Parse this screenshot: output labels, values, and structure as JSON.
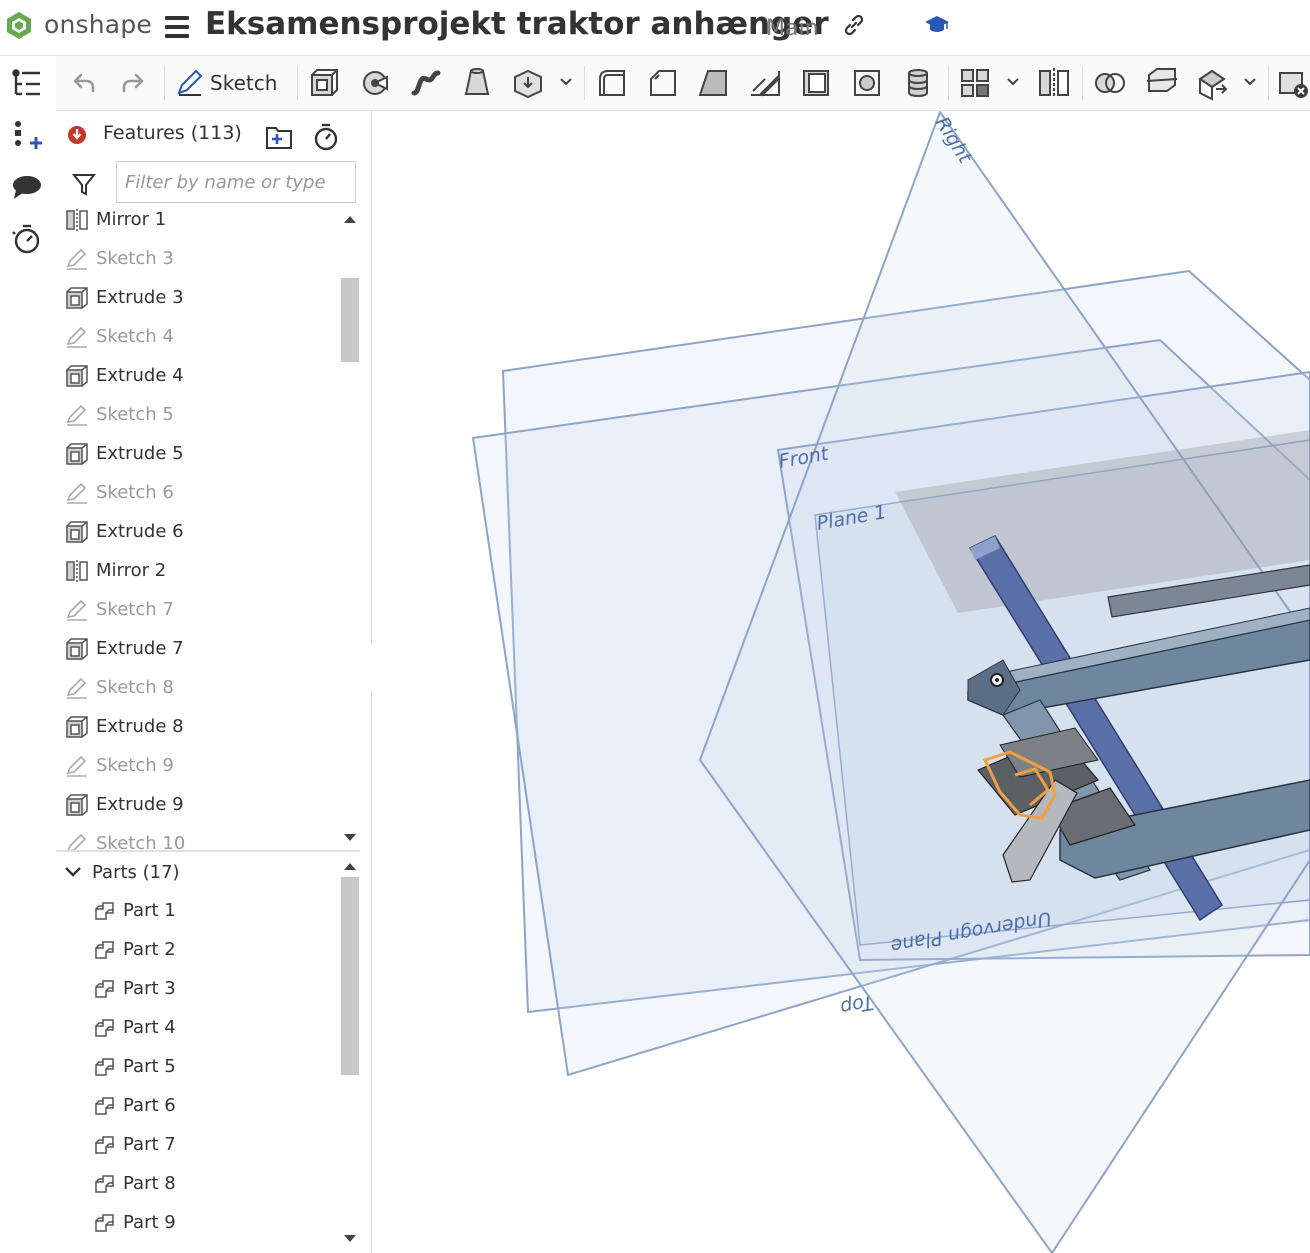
{
  "app": {
    "brand": "onshape"
  },
  "document": {
    "title": "Eksamensprojekt traktor anhænger",
    "branch": "Main"
  },
  "icons": {
    "logo": "onshape-logo-icon",
    "menu": "hamburger-menu-icon",
    "link": "link-icon",
    "education": "graduation-cap-icon"
  },
  "left_rail": [
    "feature-tree-icon",
    "insert-icon",
    "comments-icon",
    "timer-icon"
  ],
  "toolbar": {
    "sketch_label": "Sketch",
    "tools": [
      "undo",
      "redo",
      "sketch",
      "extrude",
      "revolve",
      "sweep",
      "loft",
      "thicken",
      "fillet",
      "chamfer",
      "draft",
      "rib",
      "shell",
      "hole",
      "cylinder",
      "pattern",
      "mirror",
      "boolean",
      "split",
      "transform",
      "delete-part"
    ]
  },
  "features": {
    "title": "Features (113)",
    "filter_placeholder": "Filter by name or type",
    "items": [
      {
        "label": "Mirror 1",
        "type": "mirror"
      },
      {
        "label": "Sketch 3",
        "type": "sketch"
      },
      {
        "label": "Extrude 3",
        "type": "extrude"
      },
      {
        "label": "Sketch 4",
        "type": "sketch"
      },
      {
        "label": "Extrude 4",
        "type": "extrude"
      },
      {
        "label": "Sketch 5",
        "type": "sketch"
      },
      {
        "label": "Extrude 5",
        "type": "extrude"
      },
      {
        "label": "Sketch 6",
        "type": "sketch"
      },
      {
        "label": "Extrude 6",
        "type": "extrude"
      },
      {
        "label": "Mirror 2",
        "type": "mirror"
      },
      {
        "label": "Sketch 7",
        "type": "sketch"
      },
      {
        "label": "Extrude 7",
        "type": "extrude"
      },
      {
        "label": "Sketch 8",
        "type": "sketch"
      },
      {
        "label": "Extrude 8",
        "type": "extrude"
      },
      {
        "label": "Sketch 9",
        "type": "sketch"
      },
      {
        "label": "Extrude 9",
        "type": "extrude"
      },
      {
        "label": "Sketch 10",
        "type": "sketch"
      }
    ]
  },
  "parts": {
    "title": "Parts (17)",
    "items": [
      "Part 1",
      "Part 2",
      "Part 3",
      "Part 4",
      "Part 5",
      "Part 6",
      "Part 7",
      "Part 8",
      "Part 9"
    ]
  },
  "viewport": {
    "plane_labels": {
      "right": "Right",
      "front": "Front",
      "plane1": "Plane 1",
      "underside": "Undervogn Plane",
      "top": "Top"
    },
    "plane_color": "#4d6ea8",
    "part_color": "#6e879f",
    "selection_color": "#f0a040"
  }
}
